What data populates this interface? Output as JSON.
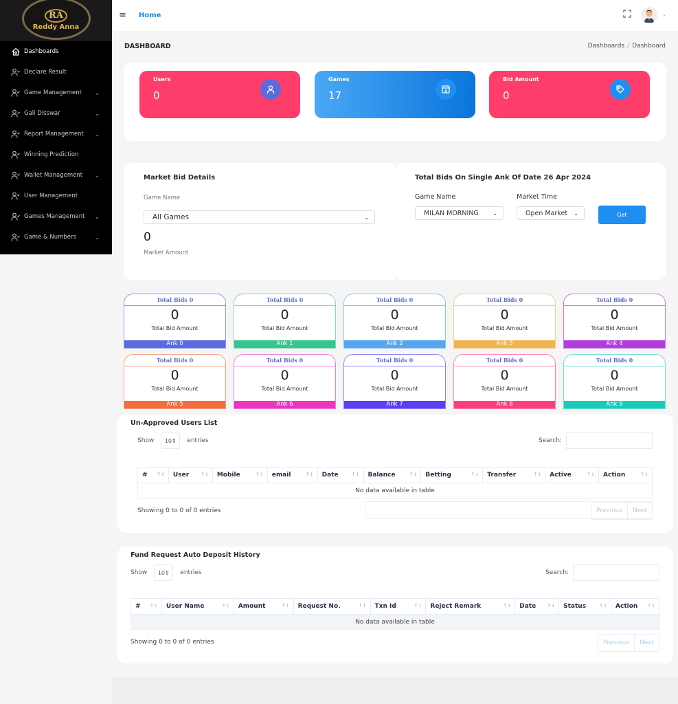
{
  "sidebar": {
    "logo": {
      "monogram": "RA",
      "text": "Reddy Anna"
    },
    "items": [
      {
        "label": "Dashboards",
        "icon": "home-icon",
        "chevron": false,
        "active": true
      },
      {
        "label": "Declare Result",
        "icon": "user-check-icon",
        "chevron": false
      },
      {
        "label": "Game Management",
        "icon": "user-check-icon",
        "chevron": true
      },
      {
        "label": "Gali Disswar",
        "icon": "user-check-icon",
        "chevron": true
      },
      {
        "label": "Report Management",
        "icon": "user-check-icon",
        "chevron": true
      },
      {
        "label": "Winning Prediction",
        "icon": "user-check-icon",
        "chevron": false
      },
      {
        "label": "Wallet Management",
        "icon": "user-check-icon",
        "chevron": true
      },
      {
        "label": "User Management",
        "icon": "user-check-icon",
        "chevron": false
      },
      {
        "label": "Games Management",
        "icon": "user-check-icon",
        "chevron": true
      },
      {
        "label": "Game & Numbers",
        "icon": "user-check-icon",
        "chevron": true
      }
    ]
  },
  "topbar": {
    "home_label": "Home"
  },
  "page": {
    "title": "DASHBOARD",
    "breadcrumb": [
      "Dashboards",
      "Dashboard"
    ]
  },
  "stats": [
    {
      "label": "Users",
      "value": "0",
      "icon": "user-icon",
      "color_from": "#ff3d6b",
      "color_to": "#ff3d6b",
      "icon_bg": "#5a6be0"
    },
    {
      "label": "Games",
      "value": "17",
      "icon": "archive-download-icon",
      "color_from": "#4aa8f5",
      "color_to": "#0a75dc",
      "icon_bg": "#1e90f5"
    },
    {
      "label": "Bid Amount",
      "value": "0",
      "icon": "tag-icon",
      "color_from": "#ff3d6b",
      "color_to": "#ff3d6b",
      "icon_bg": "#1e90f5"
    }
  ],
  "market_bid": {
    "title": "Market Bid Details",
    "game_name_label": "Game Name",
    "game_select_value": "All Games",
    "amount": "0",
    "amount_label": "Market Amount"
  },
  "single_ank": {
    "title": "Total Bids On Single Ank Of Date 26 Apr 2024",
    "game_name_label": "Game Name",
    "game_select_value": "MILAN MORNING",
    "market_time_label": "Market Time",
    "market_select_value": "Open Market",
    "get_button": "Get"
  },
  "anks": [
    {
      "header": "Total Bids 0",
      "amount": "0",
      "amount_label": "Total Bid Amount",
      "footer": "Ank 0",
      "color": "#5a6be0",
      "border": "#8c9af0"
    },
    {
      "header": "Total Bids 0",
      "amount": "0",
      "amount_label": "Total Bid Amount",
      "footer": "Ank 1",
      "color": "#36c48f",
      "border": "#7fdcb8"
    },
    {
      "header": "Total Bids 0",
      "amount": "0",
      "amount_label": "Total Bid Amount",
      "footer": "Ank 2",
      "color": "#55a6ee",
      "border": "#8cc3f3"
    },
    {
      "header": "Total Bids 0",
      "amount": "0",
      "amount_label": "Total Bid Amount",
      "footer": "Ank 3",
      "color": "#f0b54e",
      "border": "#f5cf8e"
    },
    {
      "header": "Total Bids 0",
      "amount": "0",
      "amount_label": "Total Bid Amount",
      "footer": "Ank 4",
      "color": "#b03ddc",
      "border": "#c97ae8"
    },
    {
      "header": "Total Bids 0",
      "amount": "0",
      "amount_label": "Total Bid Amount",
      "footer": "Ank 5",
      "color": "#f26d3d",
      "border": "#f6a07f"
    },
    {
      "header": "Total Bids 0",
      "amount": "0",
      "amount_label": "Total Bid Amount",
      "footer": "Ank 6",
      "color": "#e935c1",
      "border": "#f07fd8"
    },
    {
      "header": "Total Bids 0",
      "amount": "0",
      "amount_label": "Total Bid Amount",
      "footer": "Ank 7",
      "color": "#5b3ff5",
      "border": "#9282f7"
    },
    {
      "header": "Total Bids 0",
      "amount": "0",
      "amount_label": "Total Bid Amount",
      "footer": "Ank 8",
      "color": "#ff3d80",
      "border": "#ff85ae"
    },
    {
      "header": "Total Bids 0",
      "amount": "0",
      "amount_label": "Total Bid Amount",
      "footer": "Ank 9",
      "color": "#15cdb9",
      "border": "#6fe0d3"
    }
  ],
  "unapproved": {
    "title": "Un-Approved Users List",
    "show_label": "Show",
    "length_value": "10",
    "entries_label": "entries",
    "search_label": "Search:",
    "columns": [
      "#",
      "User",
      "Mobile",
      "email",
      "Date",
      "Balance",
      "Betting",
      "Transfer",
      "Active",
      "Action"
    ],
    "empty_text": "No data available in table",
    "info": "Showing 0 to 0 of 0 entries",
    "prev": "Previous",
    "next": "Next"
  },
  "fund_history": {
    "title": "Fund Request Auto Deposit History",
    "show_label": "Show",
    "length_value": "10",
    "entries_label": "entries",
    "search_label": "Search:",
    "columns": [
      "#",
      "User Name",
      "Amount",
      "Request No.",
      "Txn Id",
      "Reject Remark",
      "Date",
      "Status",
      "Action"
    ],
    "empty_text": "No data available in table",
    "info": "Showing 0 to 0 of 0 entries",
    "prev": "Previous",
    "next": "Next"
  }
}
